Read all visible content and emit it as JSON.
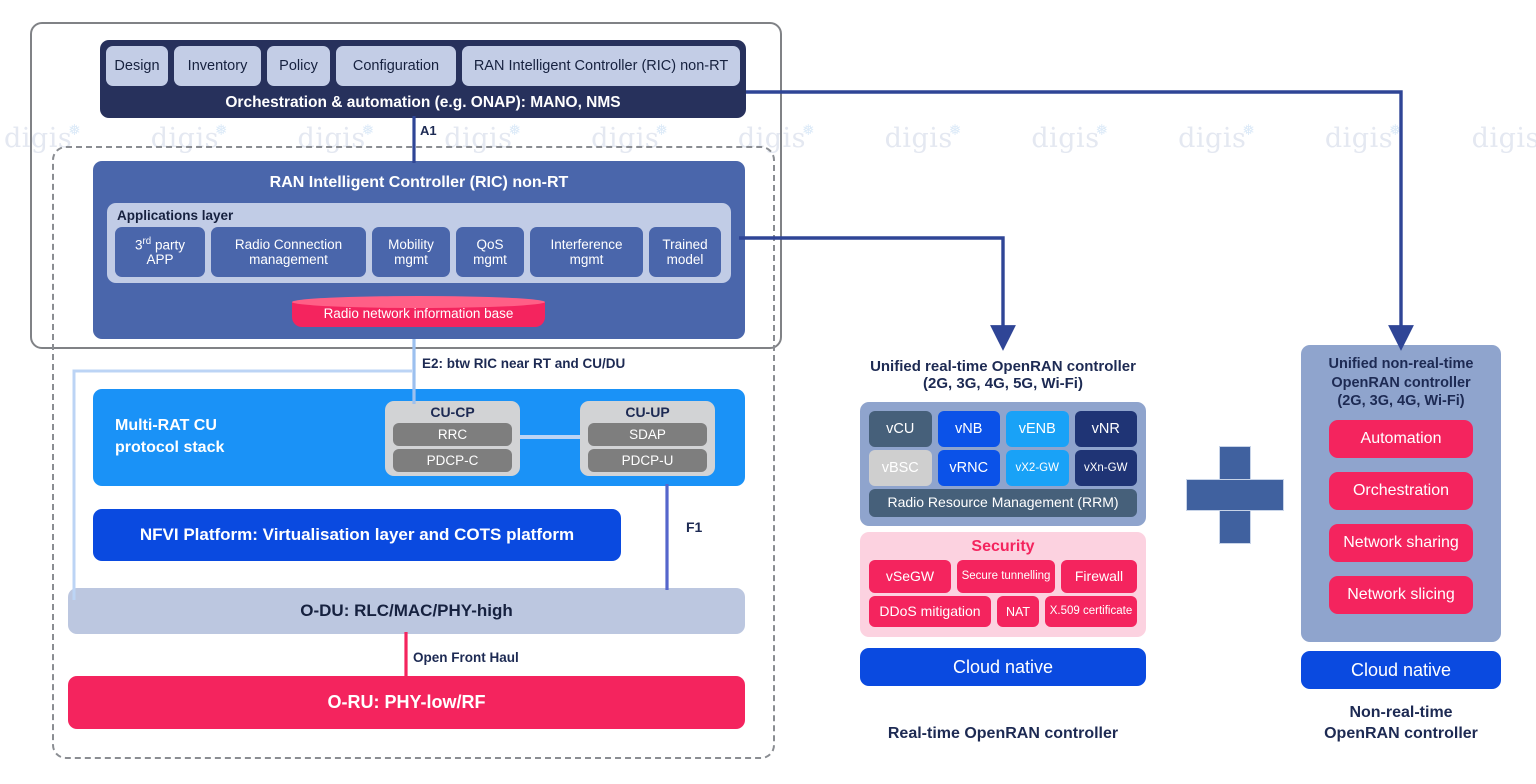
{
  "watermark": {
    "text": "digis",
    "repeat": 11
  },
  "left_panel": {
    "orchestration": {
      "chips": [
        "Design",
        "Inventory",
        "Policy",
        "Configuration",
        "RAN Intelligent Controller (RIC) non-RT"
      ],
      "bar_label": "Orchestration & automation (e.g. ONAP): MANO, NMS"
    },
    "interfaces": {
      "a1": "A1",
      "e2": "E2: btw RIC near RT and CU/DU",
      "f1": "F1",
      "front_haul": "Open Front Haul"
    },
    "ric": {
      "title": "RAN Intelligent Controller (RIC) non-RT",
      "apps_layer_label": "Applications layer",
      "apps": [
        {
          "line1": "3",
          "sup": "rd",
          "line1b": " party",
          "line2": "APP"
        },
        {
          "line1": "Radio Connection",
          "line2": "management"
        },
        {
          "line1": "Mobility",
          "line2": "mgmt"
        },
        {
          "line1": "QoS",
          "line2": "mgmt"
        },
        {
          "line1": "Interference",
          "line2": "mgmt"
        },
        {
          "line1": "Trained",
          "line2": "model"
        }
      ],
      "database": "Radio network information base"
    },
    "cu": {
      "stack_label_l1": "Multi-RAT CU",
      "stack_label_l2": "protocol stack",
      "cu_cp": {
        "title": "CU-CP",
        "items": [
          "RRC",
          "PDCP-C"
        ]
      },
      "cu_up": {
        "title": "CU-UP",
        "items": [
          "SDAP",
          "PDCP-U"
        ]
      }
    },
    "nfvi": "NFVI Platform: Virtualisation layer and COTS platform",
    "odu": "O-DU: RLC/MAC/PHY-high",
    "oru": "O-RU: PHY-low/RF"
  },
  "middle_panel": {
    "title_l1": "Unified real-time OpenRAN controller",
    "title_l2": "(2G, 3G, 4G, 5G, Wi-Fi)",
    "functions": [
      {
        "label": "vCU",
        "color": "#46607a"
      },
      {
        "label": "vNB",
        "color": "#0b52e8"
      },
      {
        "label": "vENB",
        "color": "#19a2f7"
      },
      {
        "label": "vNR",
        "color": "#1f3475"
      },
      {
        "label": "vBSC",
        "color": "#cfcfcf",
        "text": "#ffffff"
      },
      {
        "label": "vRNC",
        "color": "#0b52e8"
      },
      {
        "label": "vX2-GW",
        "color": "#19a2f7",
        "small": true
      },
      {
        "label": "vXn-GW",
        "color": "#1f3475",
        "small": true
      }
    ],
    "rrm": "Radio Resource Management (RRM)",
    "security": {
      "title": "Security",
      "row1": [
        "vSeGW",
        "Secure tunnelling",
        "Firewall"
      ],
      "row2": [
        "DDoS mitigation",
        "NAT",
        "X.509 certificate"
      ]
    },
    "cloud_native": "Cloud native",
    "caption": "Real-time OpenRAN controller"
  },
  "plus_symbol": "+",
  "right_panel": {
    "title_l1": "Unified non-real-time",
    "title_l2": "OpenRAN controller",
    "title_l3": "(2G, 3G, 4G, Wi-Fi)",
    "items": [
      "Automation",
      "Orchestration",
      "Network sharing",
      "Network slicing"
    ],
    "cloud_native": "Cloud native",
    "caption_l1": "Non-real-time",
    "caption_l2": "OpenRAN controller"
  },
  "colors": {
    "navy": "#27315c",
    "ric_blue": "#4a66ab",
    "pink": "#f4245e",
    "cyan": "#1a92f7",
    "blue": "#0a4ae0",
    "lavender": "#bcc7e0",
    "link": "#2f4596"
  }
}
